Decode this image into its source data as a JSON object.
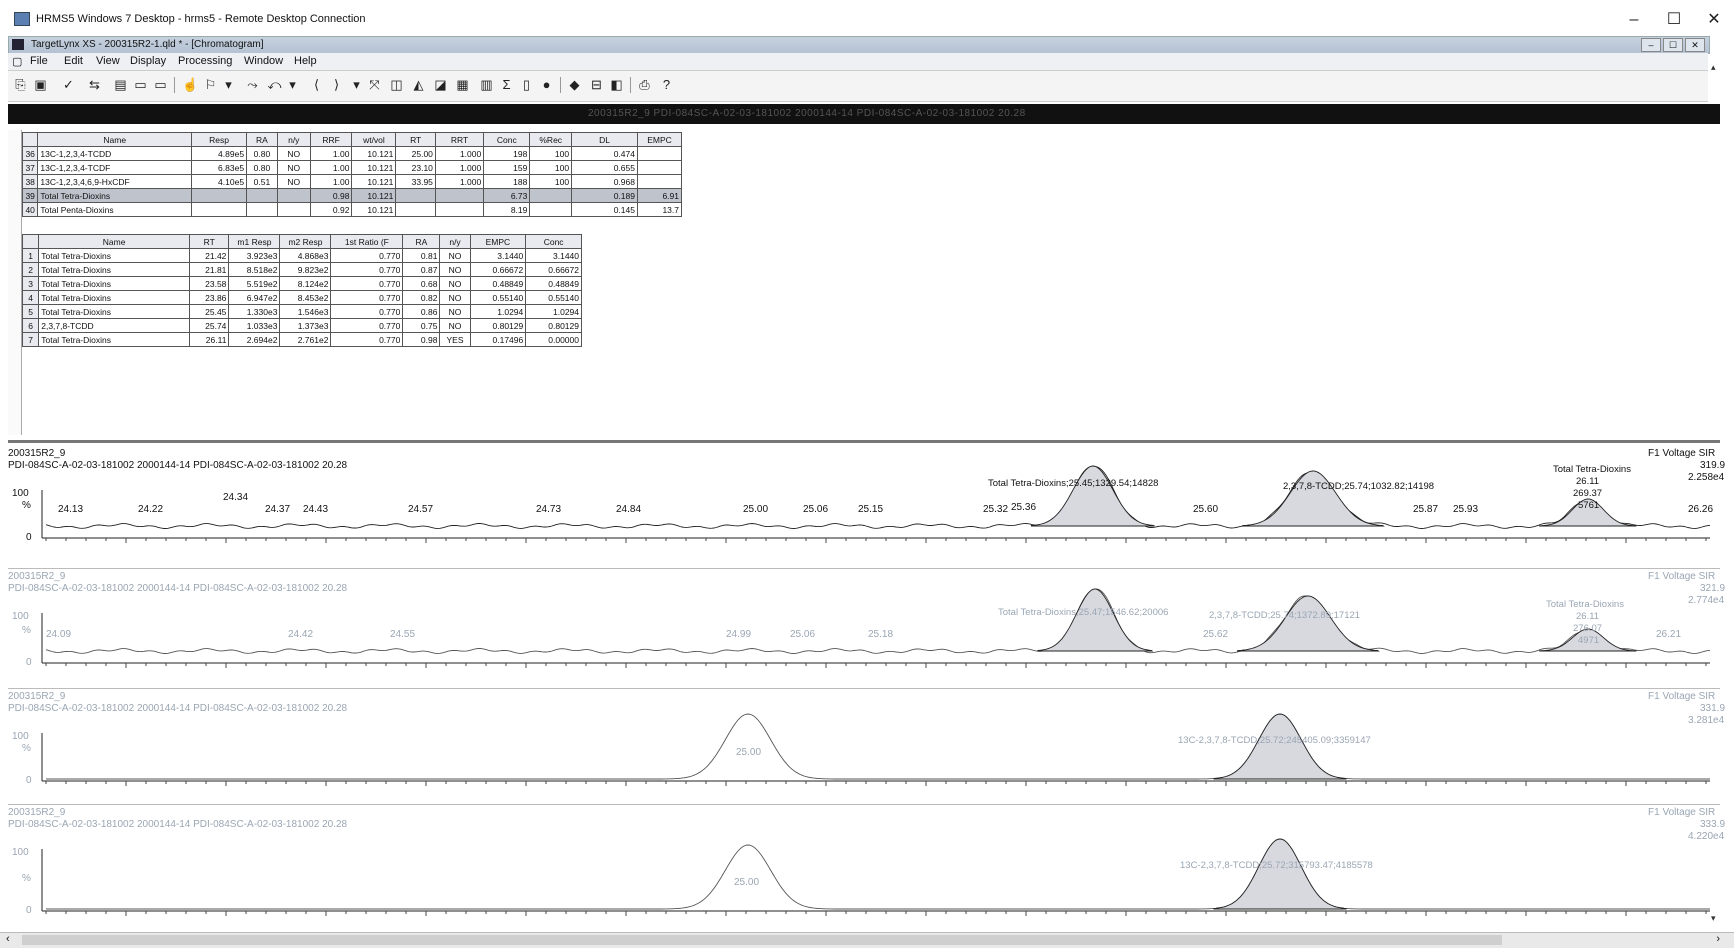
{
  "window": {
    "title": "HRMS5 Windows 7 Desktop - hrms5 - Remote Desktop Connection",
    "controls": [
      "–",
      "☐",
      "✕"
    ]
  },
  "app": {
    "title": "TargetLynx XS - 200315R2-1.qld * - [Chromatogram]",
    "inner_controls": [
      "–",
      "☐",
      "✕"
    ]
  },
  "menu": [
    "File",
    "Edit",
    "View",
    "Display",
    "Processing",
    "Window",
    "Help"
  ],
  "dark_bar_text": "200315R2_9 PDI-084SC-A-02-03-181002 2000144-14 PDI-084SC-A-02-03-181002 20.28",
  "compound_table": {
    "headers": [
      "",
      "Name",
      "Resp",
      "RA",
      "n/y",
      "RRF",
      "wt/vol",
      "RT",
      "RRT",
      "Conc",
      "%Rec",
      "DL",
      "EMPC"
    ],
    "rows": [
      [
        "36",
        "13C-1,2,3,4-TCDD",
        "4.89e5",
        "0.80",
        "NO",
        "1.00",
        "10.121",
        "25.00",
        "1.000",
        "198",
        "100",
        "0.474",
        ""
      ],
      [
        "37",
        "13C-1,2,3,4-TCDF",
        "6.83e5",
        "0.80",
        "NO",
        "1.00",
        "10.121",
        "23.10",
        "1.000",
        "159",
        "100",
        "0.655",
        ""
      ],
      [
        "38",
        "13C-1,2,3,4,6,9-HxCDF",
        "4.10e5",
        "0.51",
        "NO",
        "1.00",
        "10.121",
        "33.95",
        "1.000",
        "188",
        "100",
        "0.968",
        ""
      ],
      [
        "39",
        "Total Tetra-Dioxins",
        "",
        "",
        "",
        "0.98",
        "10.121",
        "",
        "",
        "6.73",
        "",
        "0.189",
        "6.91"
      ],
      [
        "40",
        "Total Penta-Dioxins",
        "",
        "",
        "",
        "0.92",
        "10.121",
        "",
        "",
        "8.19",
        "",
        "0.145",
        "13.7"
      ]
    ],
    "selected_row": 3
  },
  "peak_table": {
    "headers": [
      "",
      "Name",
      "RT",
      "m1 Resp",
      "m2 Resp",
      "1st Ratio (F",
      "RA",
      "n/y",
      "EMPC",
      "Conc"
    ],
    "rows": [
      [
        "1",
        "Total Tetra-Dioxins",
        "21.42",
        "3.923e3",
        "4.868e3",
        "0.770",
        "0.81",
        "NO",
        "3.1440",
        "3.1440"
      ],
      [
        "2",
        "Total Tetra-Dioxins",
        "21.81",
        "8.518e2",
        "9.823e2",
        "0.770",
        "0.87",
        "NO",
        "0.66672",
        "0.66672"
      ],
      [
        "3",
        "Total Tetra-Dioxins",
        "23.58",
        "5.519e2",
        "8.124e2",
        "0.770",
        "0.68",
        "NO",
        "0.48849",
        "0.48849"
      ],
      [
        "4",
        "Total Tetra-Dioxins",
        "23.86",
        "6.947e2",
        "8.453e2",
        "0.770",
        "0.82",
        "NO",
        "0.55140",
        "0.55140"
      ],
      [
        "5",
        "Total Tetra-Dioxins",
        "25.45",
        "1.330e3",
        "1.546e3",
        "0.770",
        "0.86",
        "NO",
        "1.0294",
        "1.0294"
      ],
      [
        "6",
        "2,3,7,8-TCDD",
        "25.74",
        "1.033e3",
        "1.373e3",
        "0.770",
        "0.75",
        "NO",
        "0.80129",
        "0.80129"
      ],
      [
        "7",
        "Total Tetra-Dioxins",
        "26.11",
        "2.694e2",
        "2.761e2",
        "0.770",
        "0.98",
        "YES",
        "0.17496",
        "0.00000"
      ]
    ]
  },
  "chromatograms": [
    {
      "sample": "200315R2_9",
      "desc": "PDI-084SC-A-02-03-181002 2000144-14 PDI-084SC-A-02-03-181002 20.28",
      "right_label": "F1 Voltage SIR",
      "right_values": [
        "319.9",
        "2.258e4"
      ],
      "y_labels": [
        "100",
        "%",
        "0"
      ],
      "faded": false,
      "ticks": [
        "24.13",
        "24.22",
        "24.34",
        "24.37",
        "24.43",
        "24.57",
        "24.73",
        "24.84",
        "25.00",
        "25.06",
        "25.15",
        "25.32",
        "25.36",
        "25.60",
        "25.87",
        "25.93",
        "26.26"
      ],
      "annotations": [
        "Total Tetra-Dioxins;25.45;1329.54;14828",
        "2,3,7,8-TCDD;25.74;1032.82;14198",
        "Total Tetra-Dioxins",
        "26.11",
        "269.37",
        "5761"
      ]
    },
    {
      "sample": "200315R2_9",
      "desc": "PDI-084SC-A-02-03-181002 2000144-14 PDI-084SC-A-02-03-181002 20.28",
      "right_label": "F1 Voltage SIR",
      "right_values": [
        "321.9",
        "2.774e4"
      ],
      "y_labels": [
        "100",
        "%",
        "0"
      ],
      "faded": true,
      "ticks": [
        "24.09",
        "24.42",
        "24.55",
        "24.99",
        "25.06",
        "25.18",
        "25.62",
        "26.21"
      ],
      "annotations": [
        "Total Tetra-Dioxins;25.47;1546.62;20006",
        "2,3,7,8-TCDD;25.74;1372.89;17121",
        "Total Tetra-Dioxins",
        "26.11",
        "276.07",
        "4971"
      ]
    },
    {
      "sample": "200315R2_9",
      "desc": "PDI-084SC-A-02-03-181002 2000144-14 PDI-084SC-A-02-03-181002 20.28",
      "right_label": "F1 Voltage SIR",
      "right_values": [
        "331.9",
        "3.281e4"
      ],
      "y_labels": [
        "100",
        "%",
        "0"
      ],
      "faded": true,
      "ticks": [
        "25.00"
      ],
      "annotations": [
        "13C-2,3,7,8-TCDD;25.72;245405.09;3359147"
      ]
    },
    {
      "sample": "200315R2_9",
      "desc": "PDI-084SC-A-02-03-181002 2000144-14 PDI-084SC-A-02-03-181002 20.28",
      "right_label": "F1 Voltage SIR",
      "right_values": [
        "333.9",
        "4.220e4"
      ],
      "y_labels": [
        "100",
        "%",
        "0"
      ],
      "faded": true,
      "ticks": [
        "25.00"
      ],
      "annotations": [
        "13C-2,3,7,8-TCDD;25.72;315793.47;4185578"
      ]
    }
  ]
}
